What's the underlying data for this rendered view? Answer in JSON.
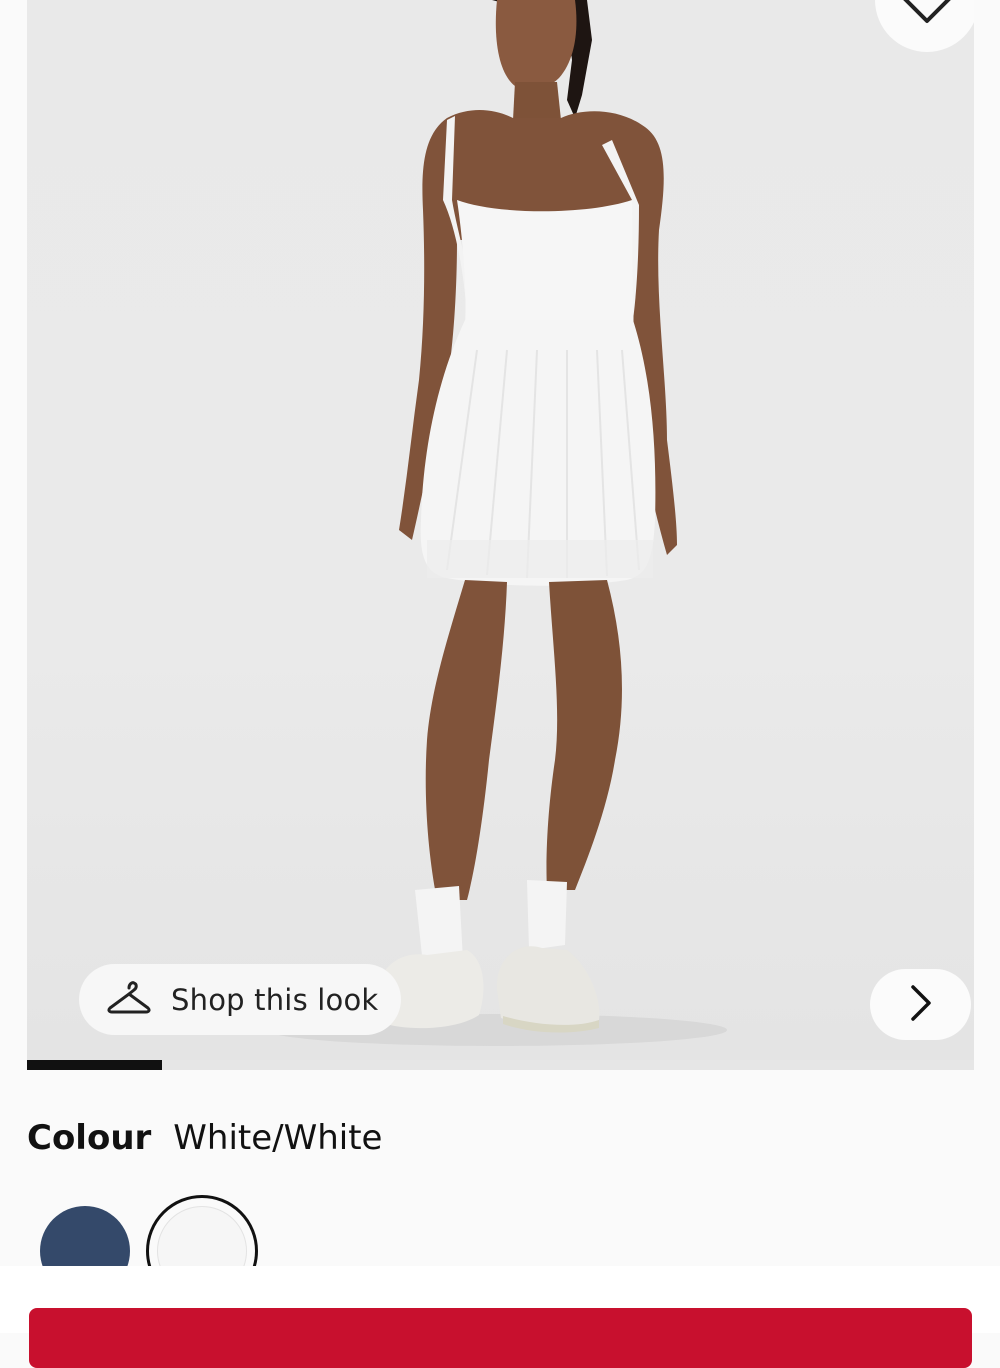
{
  "gallery": {
    "image_alt": "product photo",
    "shop_look_label": "Shop this look",
    "progress": 0.143,
    "icons": {
      "wishlist": "heart-outline-icon",
      "shop_look": "hanger-icon",
      "next": "chevron-right-icon"
    }
  },
  "product": {
    "colour_label": "Colour",
    "colour_value": "White/White",
    "swatches": [
      {
        "name": "navy",
        "color": "#34496a",
        "selected": false
      },
      {
        "name": "White/White",
        "color": "#f6f6f6",
        "selected": true
      }
    ]
  },
  "cta": {
    "add_to_bag_label": "",
    "color": "#c8102e"
  }
}
